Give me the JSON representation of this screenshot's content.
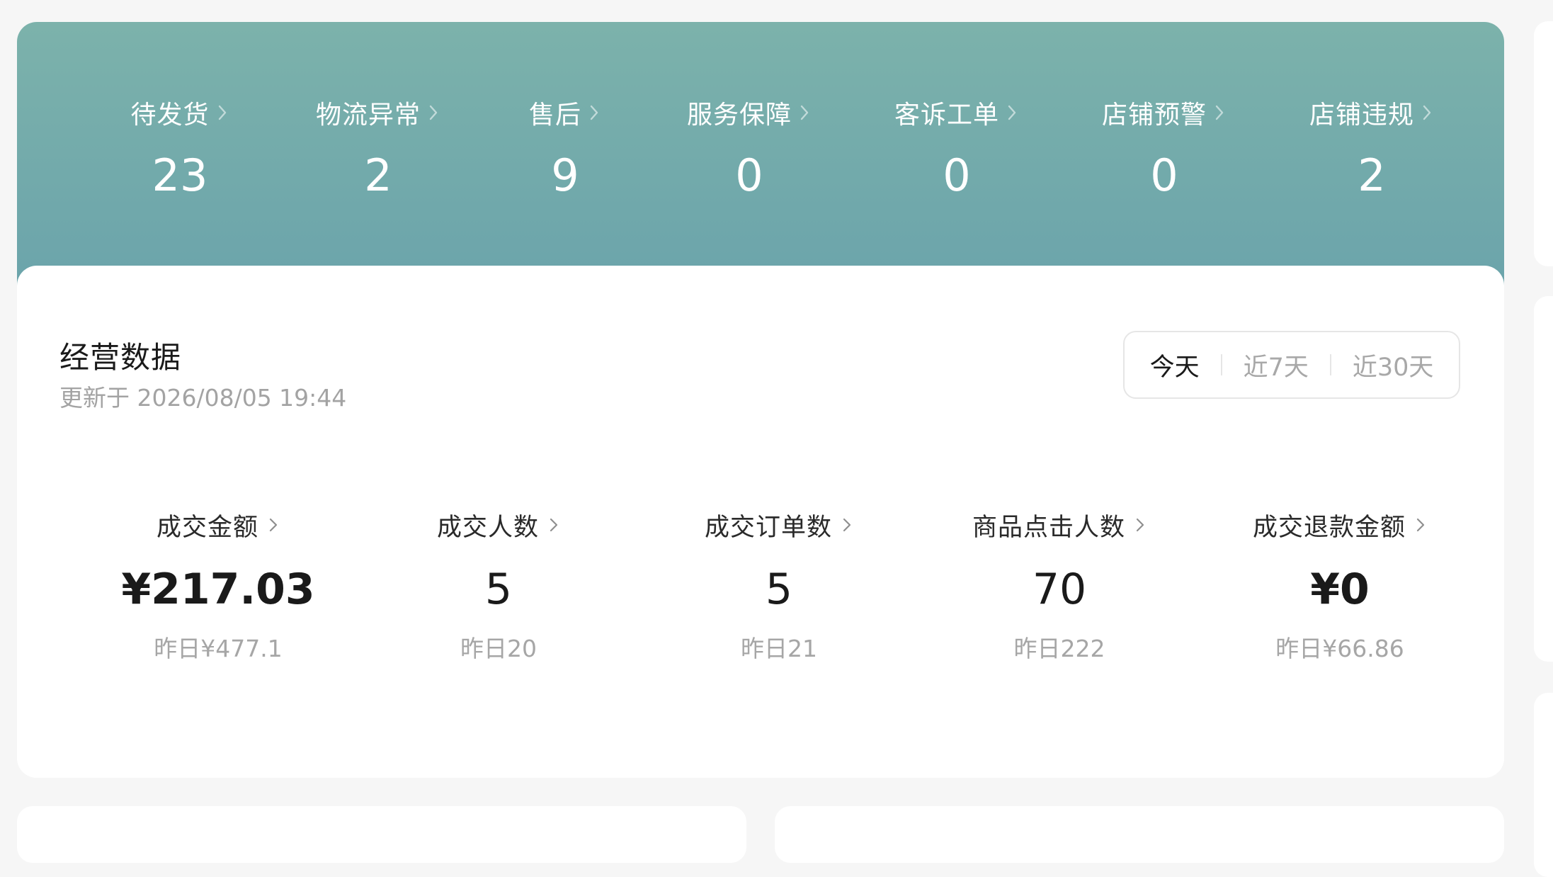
{
  "banner": {
    "background_top": "#7cb2ab",
    "background_bottom": "#6aa3ab",
    "stats": [
      {
        "label": "待发货",
        "value": "23"
      },
      {
        "label": "物流异常",
        "value": "2"
      },
      {
        "label": "售后",
        "value": "9"
      },
      {
        "label": "服务保障",
        "value": "0"
      },
      {
        "label": "客诉工单",
        "value": "0"
      },
      {
        "label": "店铺预警",
        "value": "0"
      },
      {
        "label": "店铺违规",
        "value": "2"
      }
    ]
  },
  "business": {
    "title": "经营数据",
    "updated": "更新于 2026/08/05 19:44",
    "ranges": [
      {
        "label": "今天",
        "active": true
      },
      {
        "label": "近7天",
        "active": false
      },
      {
        "label": "近30天",
        "active": false
      }
    ],
    "metrics": [
      {
        "label": "成交金额",
        "value": "¥217.03",
        "yesterday": "昨日¥477.1"
      },
      {
        "label": "成交人数",
        "value": "5",
        "yesterday": "昨日20"
      },
      {
        "label": "成交订单数",
        "value": "5",
        "yesterday": "昨日21"
      },
      {
        "label": "商品点击人数",
        "value": "70",
        "yesterday": "昨日222"
      },
      {
        "label": "成交退款金额",
        "value": "¥0",
        "yesterday": "昨日¥66.86"
      }
    ]
  },
  "icons": {
    "chevron": "chevron-right-icon"
  }
}
